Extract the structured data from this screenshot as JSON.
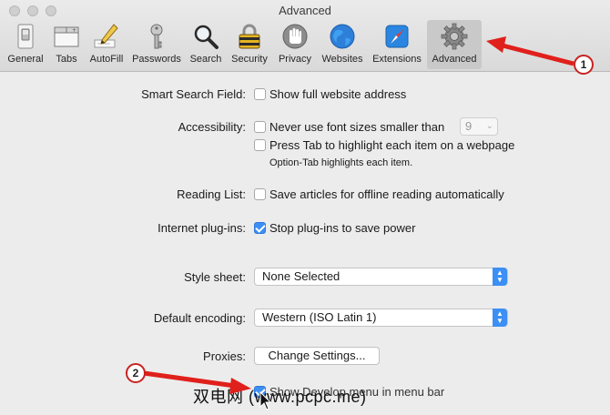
{
  "window": {
    "title": "Advanced"
  },
  "toolbar": {
    "tabs": [
      {
        "label": "General",
        "icon": "switch-icon"
      },
      {
        "label": "Tabs",
        "icon": "tabs-icon"
      },
      {
        "label": "AutoFill",
        "icon": "pencil-icon"
      },
      {
        "label": "Passwords",
        "icon": "key-icon"
      },
      {
        "label": "Search",
        "icon": "magnifier-icon"
      },
      {
        "label": "Security",
        "icon": "padlock-icon"
      },
      {
        "label": "Privacy",
        "icon": "hand-icon"
      },
      {
        "label": "Websites",
        "icon": "globe-icon"
      },
      {
        "label": "Extensions",
        "icon": "puzzle-icon"
      },
      {
        "label": "Advanced",
        "icon": "gear-icon"
      }
    ],
    "active_tab": "Advanced"
  },
  "settings": {
    "smart_search": {
      "label": "Smart Search Field:",
      "option": "Show full website address",
      "checked": false
    },
    "accessibility": {
      "label": "Accessibility:",
      "min_font_option": "Never use font sizes smaller than",
      "min_font_value": "9",
      "tab_option": "Press Tab to highlight each item on a webpage",
      "tab_hint": "Option-Tab highlights each item.",
      "checked": false
    },
    "reading_list": {
      "label": "Reading List:",
      "option": "Save articles for offline reading automatically",
      "checked": false
    },
    "plugins": {
      "label": "Internet plug-ins:",
      "option": "Stop plug-ins to save power",
      "checked": true
    },
    "style_sheet": {
      "label": "Style sheet:",
      "value": "None Selected"
    },
    "encoding": {
      "label": "Default encoding:",
      "value": "Western (ISO Latin 1)"
    },
    "proxies": {
      "label": "Proxies:",
      "button": "Change Settings..."
    },
    "develop_menu": {
      "option": "Show Develop menu in menu bar",
      "checked": true
    }
  },
  "annotations": {
    "callout1": "1",
    "callout2": "2",
    "arrow_color": "#e0201b",
    "watermark": "双电网 (www.pcpc.me)"
  },
  "colors": {
    "accent": "#3b8ff5",
    "window_bg": "#ececec"
  }
}
